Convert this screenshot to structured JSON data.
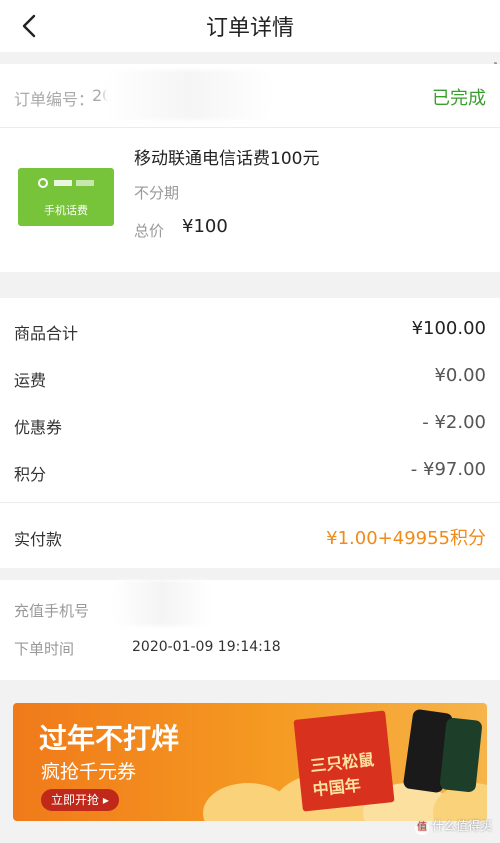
{
  "nav": {
    "title": "订单详情"
  },
  "order": {
    "number_label": "订单编号：",
    "number_visible": "20",
    "status": "已完成"
  },
  "product": {
    "image_label": "手机话费",
    "name": "移动联通电信话费100元",
    "installment": "不分期",
    "total_label": "总价",
    "total_value": "¥100"
  },
  "fees": [
    {
      "label": "商品合计",
      "value": "¥100.00"
    },
    {
      "label": "运费",
      "value": "¥0.00"
    },
    {
      "label": "优惠券",
      "value": "- ¥2.00"
    },
    {
      "label": "积分",
      "value": "- ¥97.00"
    }
  ],
  "payment": {
    "label": "实付款",
    "value": "¥1.00+49955积分"
  },
  "info": {
    "phone_label": "充值手机号",
    "time_label": "下单时间",
    "time_value": "2020-01-09 19:14:18"
  },
  "banner": {
    "headline": "过年不打烊",
    "subline": "疯抢千元券",
    "button": "立即开抢",
    "box_text": "三只松鼠 中国年"
  },
  "watermark": {
    "text": "什么值得买",
    "icon": "值"
  },
  "colors": {
    "status_green": "#3a9e2e",
    "payment_orange": "#f08b18",
    "banner_orange": "#f07a1a"
  }
}
